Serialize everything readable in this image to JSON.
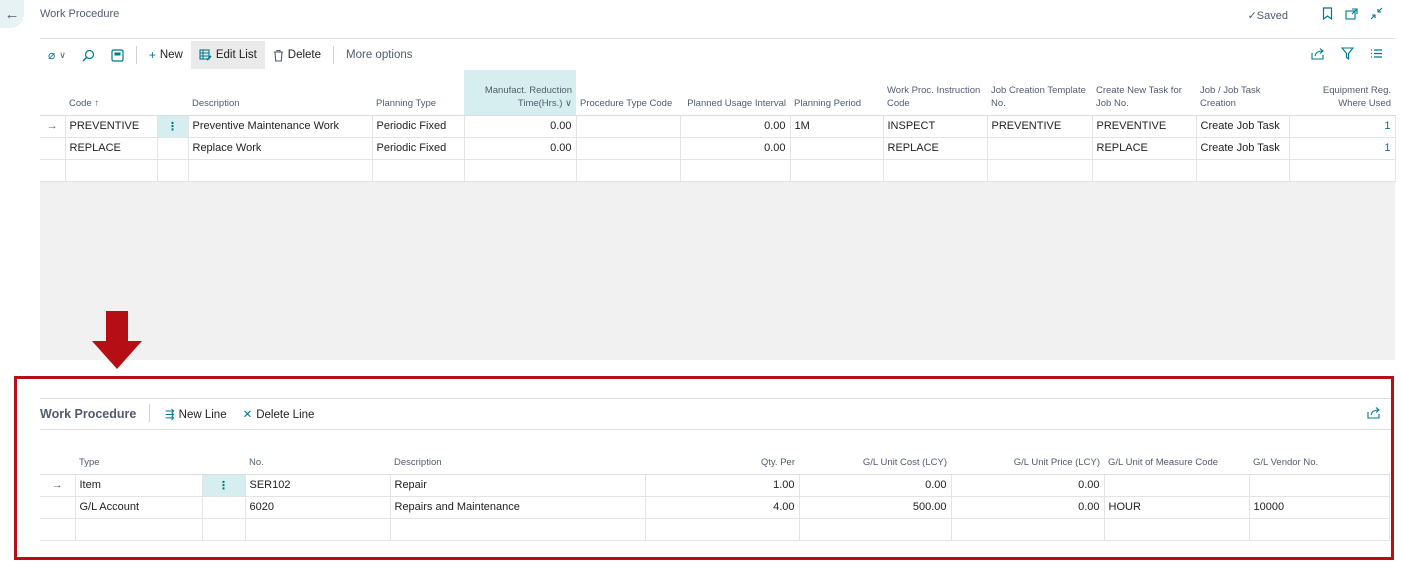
{
  "header": {
    "title": "Work Procedure",
    "saved_label": "Saved"
  },
  "toolbar": {
    "new_label": "New",
    "edit_list_label": "Edit List",
    "delete_label": "Delete",
    "more_options_label": "More options"
  },
  "main_grid": {
    "columns": [
      "Code",
      "Description",
      "Planning Type",
      "Manufact. Reduction Time(Hrs.)",
      "Procedure Type Code",
      "Planned Usage Interval",
      "Planning Period",
      "Work Proc. Instruction Code",
      "Job Creation Template No.",
      "Create New Task for Job No.",
      "Job / Job Task Creation",
      "Equipment Reg. Where Used"
    ],
    "sort_indicator": "↑",
    "rows": [
      {
        "code": "PREVENTIVE",
        "description": "Preventive Maintenance Work",
        "planning_type": "Periodic Fixed",
        "manufact": "0.00",
        "procedure_type": "",
        "planned_usage": "0.00",
        "planning_period": "1M",
        "instruction_code": "INSPECT",
        "template_no": "PREVENTIVE",
        "create_task": "PREVENTIVE",
        "job_creation": "Create Job Task",
        "where_used": "1"
      },
      {
        "code": "REPLACE",
        "description": "Replace Work",
        "planning_type": "Periodic Fixed",
        "manufact": "0.00",
        "procedure_type": "",
        "planned_usage": "0.00",
        "planning_period": "",
        "instruction_code": "REPLACE",
        "template_no": "",
        "create_task": "REPLACE",
        "job_creation": "Create Job Task",
        "where_used": "1"
      }
    ]
  },
  "subpage": {
    "title": "Work Procedure",
    "new_line_label": "New Line",
    "delete_line_label": "Delete Line",
    "columns": [
      "Type",
      "No.",
      "Description",
      "Qty. Per",
      "G/L Unit Cost (LCY)",
      "G/L Unit Price (LCY)",
      "G/L Unit of Measure Code",
      "G/L Vendor No."
    ],
    "rows": [
      {
        "type": "Item",
        "no": "SER102",
        "description": "Repair",
        "qty": "1.00",
        "cost": "0.00",
        "price": "0.00",
        "uom": "",
        "vendor": ""
      },
      {
        "type": "G/L Account",
        "no": "6020",
        "description": "Repairs and Maintenance",
        "qty": "4.00",
        "cost": "500.00",
        "price": "0.00",
        "uom": "HOUR",
        "vendor": "10000"
      }
    ]
  },
  "colors": {
    "accent": "#00788b",
    "highlight": "#b50f15",
    "selected_column": "#d6eef0"
  }
}
